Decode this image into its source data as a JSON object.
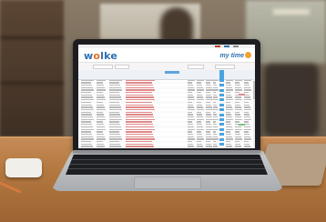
{
  "app": {
    "logo_text_pre": "w",
    "logo_text_o": "o",
    "logo_text_post": "lke",
    "product_name": "my time"
  },
  "colors": {
    "brand_blue": "#2f6fb3",
    "brand_orange": "#e56f1f",
    "highlight_column": "#4aa3e0",
    "status_red": "#e08a8a",
    "status_green": "#7cc47f"
  },
  "icons": {
    "product_icon": "clock-icon"
  }
}
